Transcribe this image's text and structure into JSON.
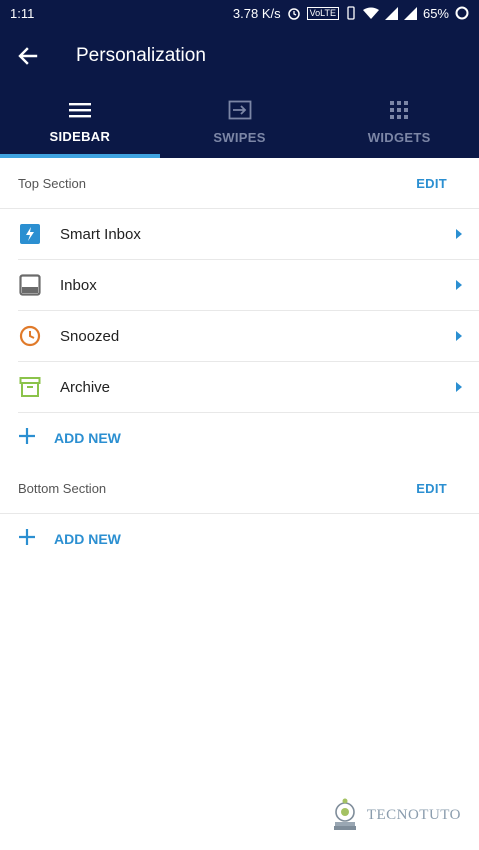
{
  "status_bar": {
    "time": "1:11",
    "speed": "3.78 K/s",
    "volte": "VoLTE",
    "battery": "65%"
  },
  "app_bar": {
    "title": "Personalization"
  },
  "tabs": [
    {
      "label": "SIDEBAR",
      "icon": "menu-icon",
      "active": true
    },
    {
      "label": "SWIPES",
      "icon": "swipe-arrow-icon",
      "active": false
    },
    {
      "label": "WIDGETS",
      "icon": "grid-icon",
      "active": false
    }
  ],
  "top_section": {
    "title": "Top Section",
    "edit_label": "EDIT",
    "items": [
      {
        "label": "Smart Inbox",
        "icon": "smart-inbox-icon",
        "color": "#2b8fd1"
      },
      {
        "label": "Inbox",
        "icon": "inbox-icon",
        "color": "#6b6b6b"
      },
      {
        "label": "Snoozed",
        "icon": "clock-icon",
        "color": "#e07a2a"
      },
      {
        "label": "Archive",
        "icon": "archive-icon",
        "color": "#8bc34a"
      }
    ],
    "add_label": "ADD NEW"
  },
  "bottom_section": {
    "title": "Bottom Section",
    "edit_label": "EDIT",
    "add_label": "ADD NEW"
  },
  "watermark": {
    "text": "TECNOTUTO"
  },
  "colors": {
    "header": "#0b1846",
    "accent": "#2b8fd1",
    "underline": "#3fa3e0"
  }
}
